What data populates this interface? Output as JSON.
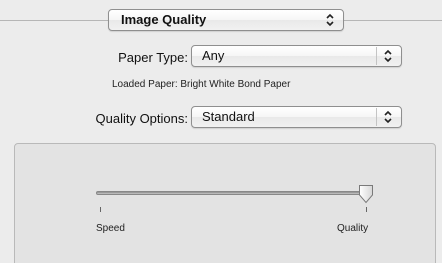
{
  "section_popup": {
    "selected": "Image Quality"
  },
  "paper_type": {
    "label": "Paper Type:",
    "selected": "Any"
  },
  "loaded_paper": {
    "text": "Loaded Paper: Bright White Bond Paper"
  },
  "quality_options": {
    "label": "Quality Options:",
    "selected": "Standard"
  },
  "quality_slider": {
    "min_label": "Speed",
    "max_label": "Quality",
    "value": 1.0
  },
  "icons": {
    "popup_arrows": "up-down-chevron-icon",
    "slider_thumb": "slider-thumb-icon"
  }
}
